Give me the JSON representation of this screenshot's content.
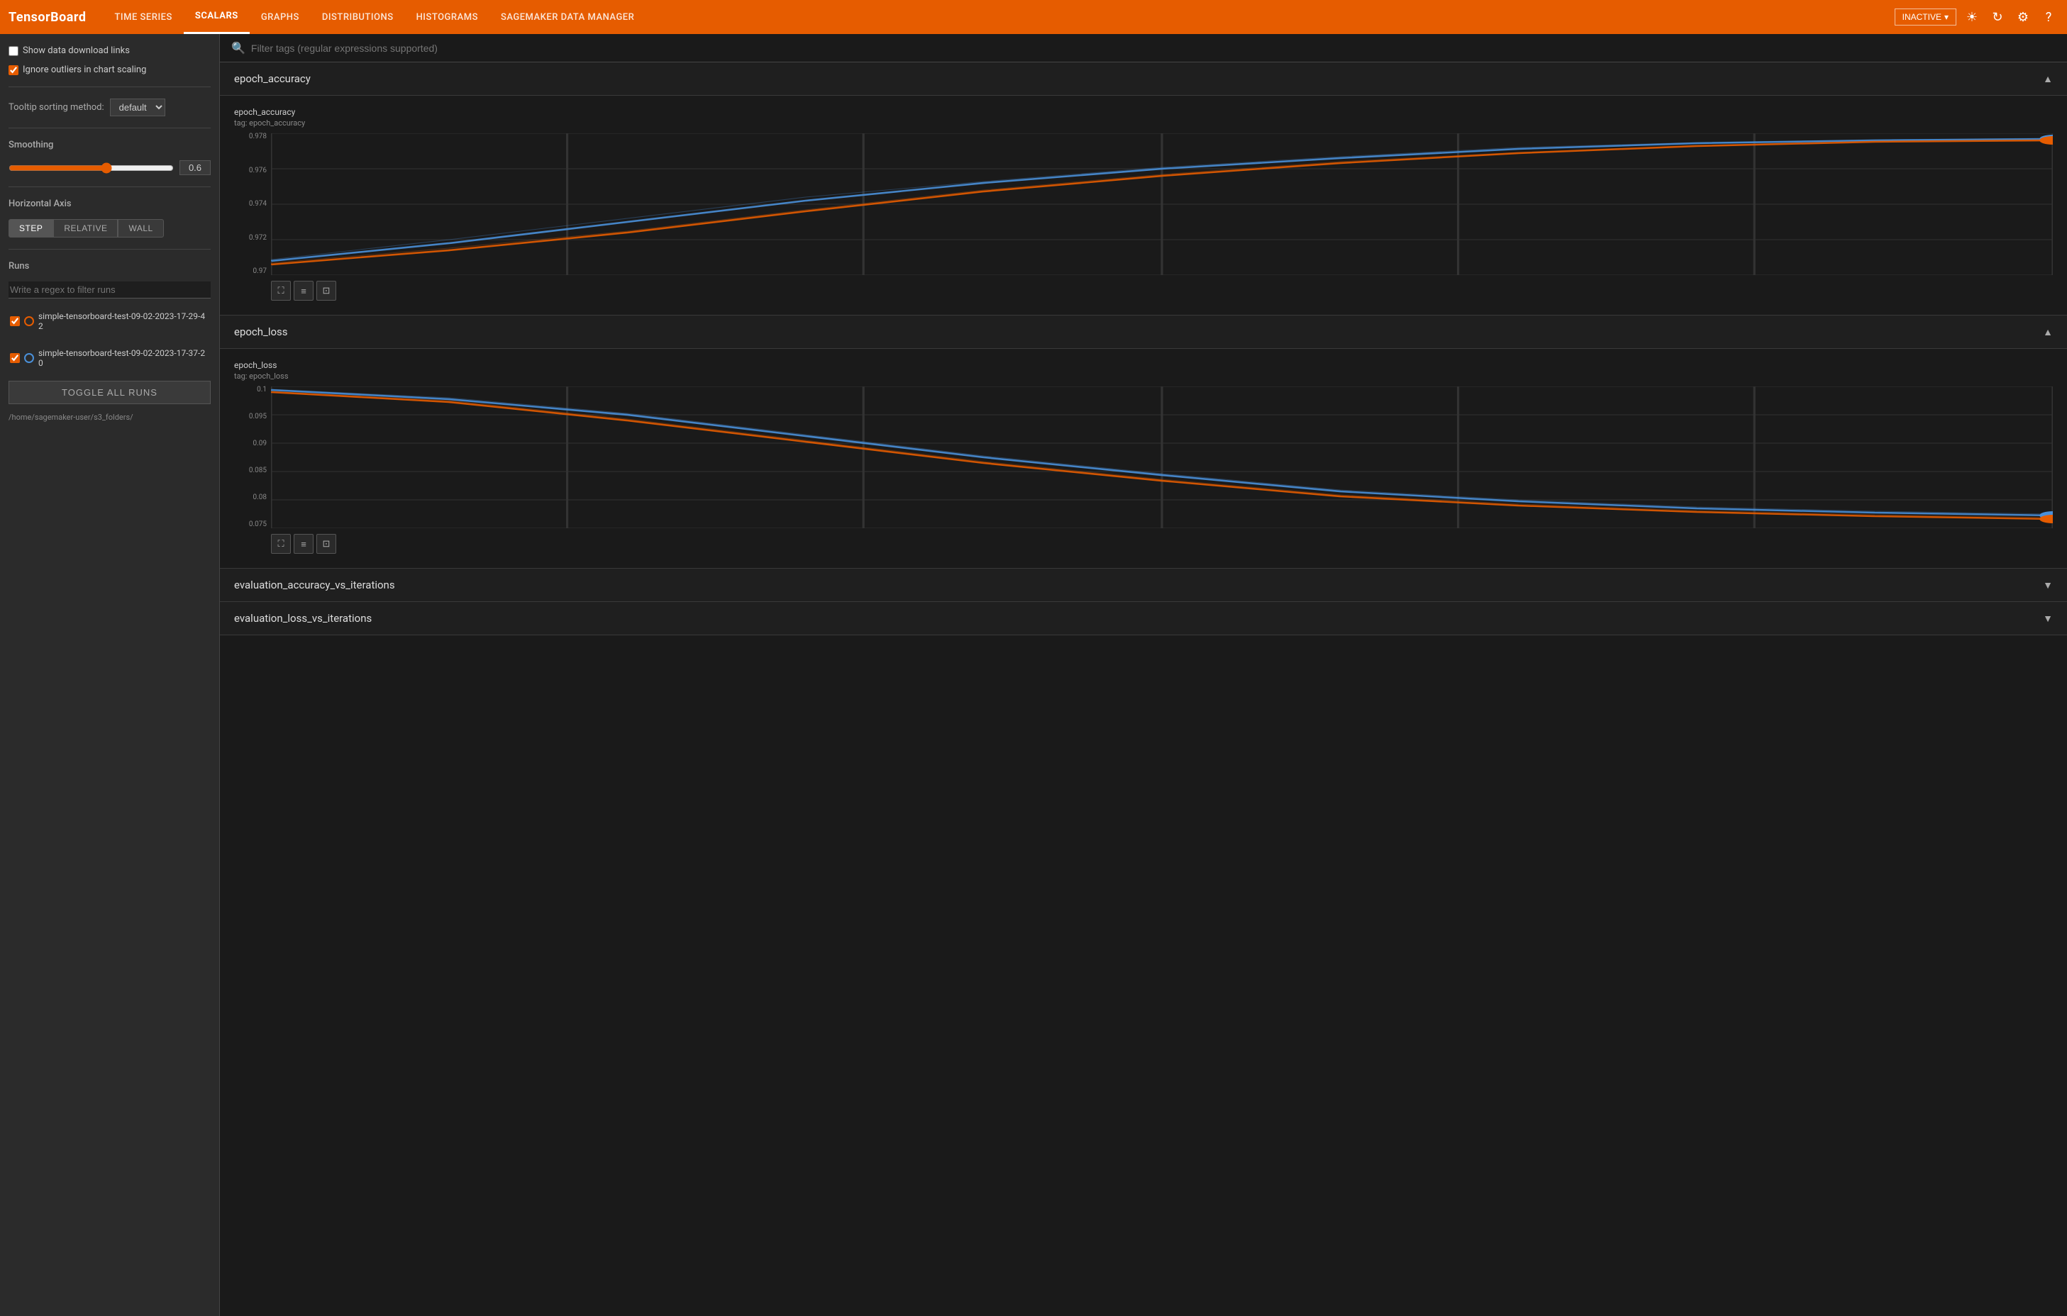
{
  "app": {
    "logo": "TensorBoard"
  },
  "nav": {
    "items": [
      {
        "label": "TIME SERIES",
        "active": false
      },
      {
        "label": "SCALARS",
        "active": true
      },
      {
        "label": "GRAPHS",
        "active": false
      },
      {
        "label": "DISTRIBUTIONS",
        "active": false
      },
      {
        "label": "HISTOGRAMS",
        "active": false
      },
      {
        "label": "SAGEMAKER DATA MANAGER",
        "active": false
      }
    ],
    "status": "INACTIVE",
    "icons": [
      "brightness",
      "refresh",
      "settings",
      "help"
    ]
  },
  "sidebar": {
    "show_download": "Show data download links",
    "ignore_outliers": "Ignore outliers in chart scaling",
    "tooltip_label": "Tooltip sorting method:",
    "tooltip_value": "default",
    "smoothing_label": "Smoothing",
    "smoothing_value": "0.6",
    "axis_label": "Horizontal Axis",
    "axis_options": [
      "STEP",
      "RELATIVE",
      "WALL"
    ],
    "axis_active": "STEP",
    "runs_label": "Runs",
    "runs_filter_placeholder": "Write a regex to filter runs",
    "runs": [
      {
        "label": "simple-tensorboard-test-09-02-2023-17-29-42",
        "color": "orange",
        "checked": true
      },
      {
        "label": "simple-tensorboard-test-09-02-2023-17-37-20",
        "color": "blue",
        "checked": true
      }
    ],
    "toggle_all_label": "TOGGLE ALL RUNS",
    "path": "/home/sagemaker-user/s3_folders/"
  },
  "search": {
    "placeholder": "Filter tags (regular expressions supported)"
  },
  "sections": [
    {
      "id": "epoch_accuracy",
      "title": "epoch_accuracy",
      "expanded": true,
      "chart": {
        "title": "epoch_accuracy",
        "subtitle": "tag: epoch_accuracy",
        "y_ticks": [
          "0.97",
          "0.972",
          "0.974",
          "0.976",
          "0.978"
        ],
        "type": "accuracy"
      }
    },
    {
      "id": "epoch_loss",
      "title": "epoch_loss",
      "expanded": true,
      "chart": {
        "title": "epoch_loss",
        "subtitle": "tag: epoch_loss",
        "y_ticks": [
          "0.075",
          "0.08",
          "0.085",
          "0.09",
          "0.095",
          "0.1"
        ],
        "type": "loss"
      }
    },
    {
      "id": "eval_acc",
      "title": "evaluation_accuracy_vs_iterations",
      "expanded": false
    },
    {
      "id": "eval_loss",
      "title": "evaluation_loss_vs_iterations",
      "expanded": false
    }
  ],
  "icons": {
    "expand": "▲",
    "collapse": "▼",
    "fullscreen": "⛶",
    "list": "≡",
    "image": "⊡",
    "search": "🔍",
    "chevron_down": "▾",
    "chevron_up": "▴"
  }
}
